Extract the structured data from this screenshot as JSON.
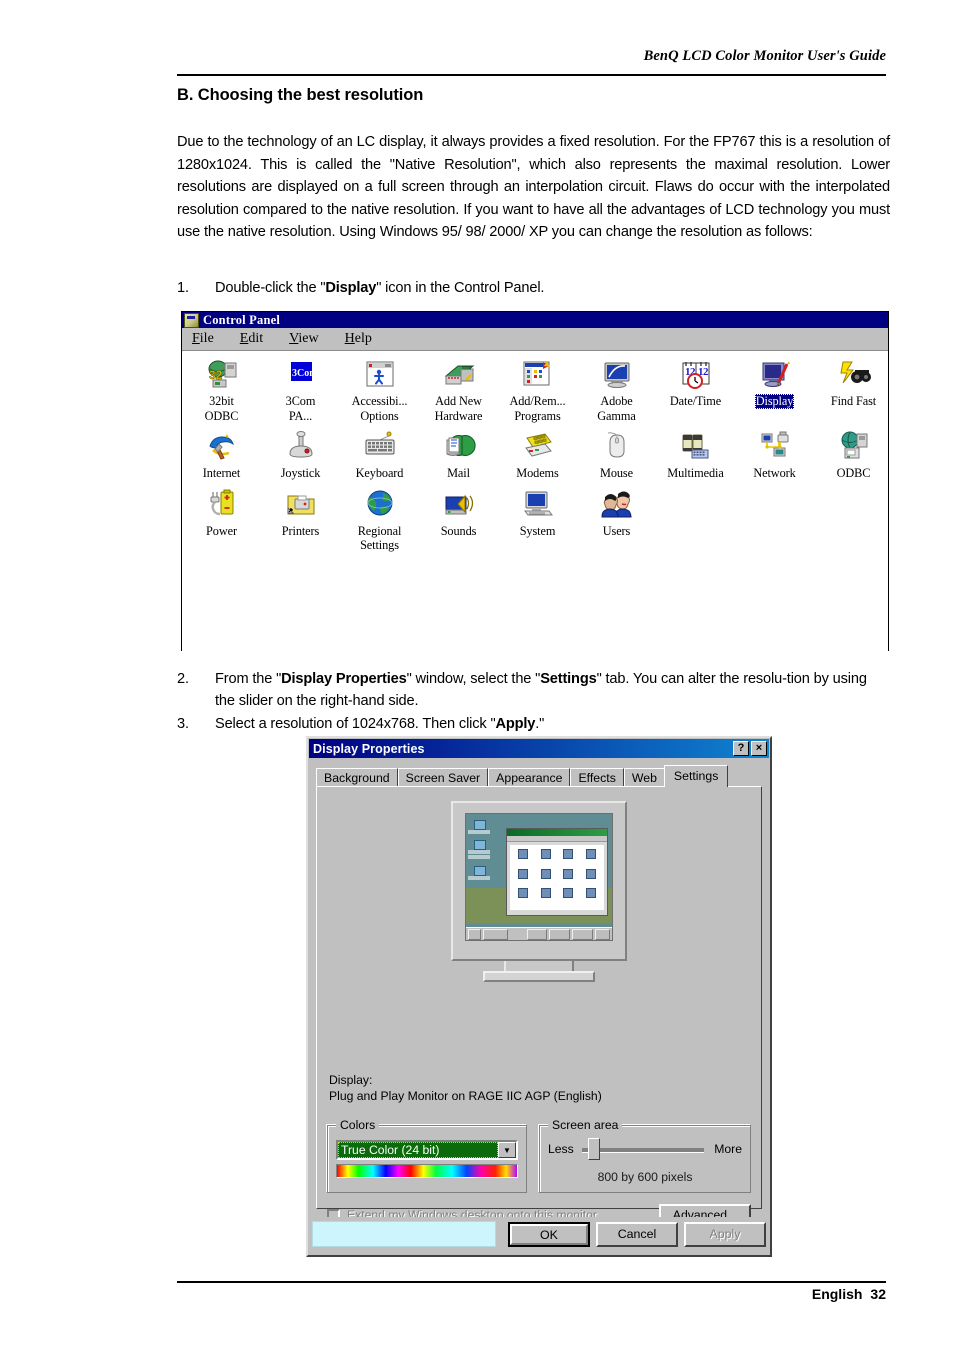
{
  "page": {
    "header_text": "BenQ LCD Color Monitor User's Guide",
    "footer_language": "English",
    "footer_page": "32",
    "section_heading": "B. Choosing the best resolution",
    "paragraph": "Due to the technology of an LC display, it always provides a fixed resolution. For the FP767 this is a resolution of 1280x1024. This is called the \"Native Resolution\", which also represents the maximal resolution. Lower resolutions are displayed on a full screen through an interpolation circuit. Flaws do occur with the interpolated resolution compared to the native resolution. If you want to have all the advantages of LCD technology you must use the native resolution. Using Windows 95/ 98/ 2000/ XP you can change the resolution as follows:"
  },
  "steps": {
    "step1": {
      "num": "1.",
      "html": "Double-click the \"<b>Display</b>\" icon in the Control Panel."
    },
    "step2": {
      "num": "2.",
      "html": "From the \"<b>Display Properties</b>\" window, select the \"<b>Settings</b>\" tab. You can alter the resolu-tion by using the slider on the right-hand side."
    },
    "step3": {
      "num": "3.",
      "html": "Select a resolution of 1024x768. Then click \"<b>Apply</b>.\""
    }
  },
  "control_panel": {
    "title": "Control Panel",
    "title_icon": "control-panel-icon",
    "menu": [
      {
        "label": "File",
        "accel": "F"
      },
      {
        "label": "Edit",
        "accel": "E"
      },
      {
        "label": "View",
        "accel": "V"
      },
      {
        "label": "Help",
        "accel": "H"
      }
    ],
    "selected_item": "Display",
    "rows": [
      [
        {
          "label": "32bit\nODBC",
          "icon": "odbc-32bit-icon"
        },
        {
          "label": "3Com\nPA...",
          "icon": "3com-icon"
        },
        {
          "label": "Accessibi...\nOptions",
          "icon": "accessibility-options-icon"
        },
        {
          "label": "Add New\nHardware",
          "icon": "add-new-hardware-icon"
        },
        {
          "label": "Add/Rem...\nPrograms",
          "icon": "add-remove-programs-icon"
        },
        {
          "label": "Adobe\nGamma",
          "icon": "adobe-gamma-icon"
        },
        {
          "label": "Date/Time",
          "icon": "date-time-icon"
        },
        {
          "label": "Display",
          "icon": "display-icon"
        },
        {
          "label": "Find Fast",
          "icon": "find-fast-icon"
        }
      ],
      [
        {
          "label": "Internet",
          "icon": "internet-icon"
        },
        {
          "label": "Joystick",
          "icon": "joystick-icon"
        },
        {
          "label": "Keyboard",
          "icon": "keyboard-icon"
        },
        {
          "label": "Mail",
          "icon": "mail-icon"
        },
        {
          "label": "Modems",
          "icon": "modems-icon"
        },
        {
          "label": "Mouse",
          "icon": "mouse-icon"
        },
        {
          "label": "Multimedia",
          "icon": "multimedia-icon"
        },
        {
          "label": "Network",
          "icon": "network-icon"
        },
        {
          "label": "ODBC",
          "icon": "odbc-icon"
        }
      ],
      [
        {
          "label": "Power",
          "icon": "power-icon"
        },
        {
          "label": "Printers",
          "icon": "printers-icon"
        },
        {
          "label": "Regional\nSettings",
          "icon": "regional-settings-icon"
        },
        {
          "label": "Sounds",
          "icon": "sounds-icon"
        },
        {
          "label": "System",
          "icon": "system-icon"
        },
        {
          "label": "Users",
          "icon": "users-icon"
        }
      ]
    ]
  },
  "display_properties": {
    "title": "Display Properties",
    "help_button": "?",
    "close_button": "×",
    "tabs": [
      {
        "label": "Background",
        "active": false
      },
      {
        "label": "Screen Saver",
        "active": false
      },
      {
        "label": "Appearance",
        "active": false
      },
      {
        "label": "Effects",
        "active": false
      },
      {
        "label": "Web",
        "active": false
      },
      {
        "label": "Settings",
        "active": true
      }
    ],
    "display_label": "Display:",
    "display_value": "Plug and Play Monitor on RAGE IIC AGP (English)",
    "colors": {
      "group_label": "Colors",
      "selected": "True Color (24 bit)",
      "dropdown_arrow": "chevron-down-icon"
    },
    "screen_area": {
      "group_label": "Screen area",
      "less_label": "Less",
      "more_label": "More",
      "resolution": "800 by 600 pixels"
    },
    "extend_checkbox": {
      "label": "Extend my Windows desktop onto this monitor.",
      "checked": true,
      "enabled": false
    },
    "advanced_button": "Advanced...",
    "buttons": {
      "ok": "OK",
      "cancel": "Cancel",
      "apply": "Apply"
    }
  },
  "colors": {
    "title_bar_blue": "#000080",
    "dialog_face": "#c0c0c0",
    "selection_blue": "#000080",
    "combo_green": "#0b6b0b",
    "desktop_teal": "#5f8d93"
  }
}
